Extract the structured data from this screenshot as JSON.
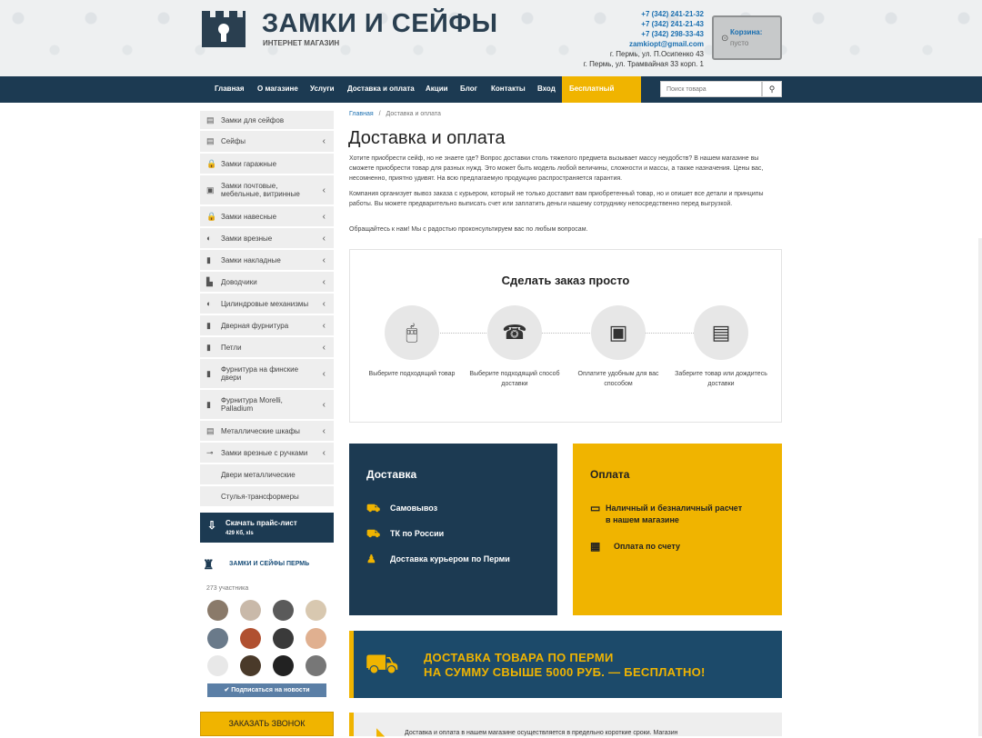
{
  "header": {
    "brand": "ЗАМКИ И СЕЙФЫ",
    "subtitle": "ИНТЕРНЕТ МАГАЗИН",
    "phones": [
      "+7 (342) 241-21-32",
      "+7 (342) 241-21-43",
      "+7 (342) 298-33-43"
    ],
    "email": "zamkiopt@gmail.com",
    "addresses": [
      "г. Пермь, ул. П.Осипенко 43",
      "г. Пермь, ул. Трамвайная 33 корп. 1"
    ],
    "cart_title": "Корзина:",
    "cart_value": "пусто"
  },
  "nav": {
    "items": [
      "Главная",
      "О магазине",
      "Услуги",
      "Доставка и оплата",
      "Акции",
      "Блог",
      "Контакты",
      "Вход"
    ],
    "callback": "Бесплатный звонок",
    "search_placeholder": "Поиск товара"
  },
  "sidebar": {
    "items": [
      {
        "label": "Замки для сейфов",
        "arrow": false
      },
      {
        "label": "Сейфы",
        "arrow": true
      },
      {
        "label": "Замки гаражные",
        "arrow": false
      },
      {
        "label": "Замки почтовые, мебельные, витринные",
        "arrow": true
      },
      {
        "label": "Замки навесные",
        "arrow": true
      },
      {
        "label": "Замки врезные",
        "arrow": true
      },
      {
        "label": "Замки накладные",
        "arrow": true
      },
      {
        "label": "Доводчики",
        "arrow": true
      },
      {
        "label": "Цилиндровые механизмы",
        "arrow": true
      },
      {
        "label": "Дверная фурнитура",
        "arrow": true
      },
      {
        "label": "Петли",
        "arrow": true
      },
      {
        "label": "Фурнитура на финские двери",
        "arrow": true
      },
      {
        "label": "Фурнитура Morelli, Palladium",
        "arrow": true
      },
      {
        "label": "Металлические шкафы",
        "arrow": true
      },
      {
        "label": "Замки врезные с ручками",
        "arrow": true
      },
      {
        "label": "Двери металлические",
        "arrow": false
      },
      {
        "label": "Стулья-трансформеры",
        "arrow": false
      }
    ],
    "price_title": "Скачать прайс-лист",
    "price_size": "429 Кб, xls"
  },
  "vk": {
    "title": "ЗАМКИ И СЕЙФЫ ПЕРМЬ",
    "count": "273 участника",
    "subscribe": "Подписаться на новости"
  },
  "callback_btn": "ЗАКАЗАТЬ ЗВОНОК",
  "breadcrumb": {
    "home": "Главная",
    "sep": "/",
    "current": "Доставка и оплата"
  },
  "page": {
    "title": "Доставка и оплата",
    "p1": "Хотите приобрести сейф, но не знаете где? Вопрос доставки столь тяжелого предмета вызывает массу неудобств? В нашем магазине вы сможете приобрести товар для разных нужд. Это может быть модель любой величины, сложности и массы, а также назначения. Цены вас, несомненно, приятно удивят. На всю предлагаемую продукцию распространяется гарантия.",
    "p2": "Компания организует вывоз заказа с курьером, который не только доставит вам приобретенный товар, но и опишет все детали и принципы работы. Вы можете предварительно выписать счет или заплатить деньги нашему сотруднику непосредственно перед выгрузкой.",
    "p3": "Обращайтесь к нам! Мы с радостью проконсультируем вас по любым вопросам."
  },
  "steps": {
    "title": "Сделать заказ просто",
    "items": [
      "Выберите подходящий товар",
      "Выберите подходящий способ доставки",
      "Оплатите удобным для вас способом",
      "Заберите товар или дождитесь доставки"
    ]
  },
  "delivery": {
    "title": "Доставка",
    "items": [
      "Самовывоз",
      "ТК по России",
      "Доставка курьером по Перми"
    ]
  },
  "payment": {
    "title": "Оплата",
    "items": [
      "Наличный и безналичный расчет в нашем магазине",
      "Оплата по счету"
    ]
  },
  "banner": {
    "line1": "ДОСТАВКА ТОВАРА ПО ПЕРМИ",
    "line2": "НА СУММУ СВЫШЕ 5000 РУБ. — БЕСПЛАТНО!"
  },
  "footer_note": "Доставка и оплата в нашем магазине осуществляется в предельно короткие сроки. Магазин"
}
